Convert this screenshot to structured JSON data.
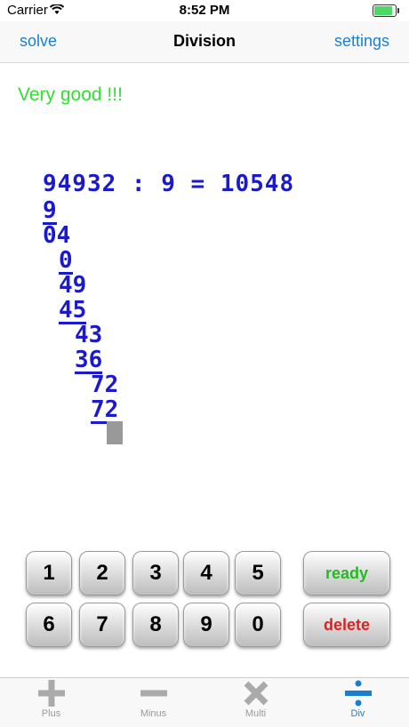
{
  "status": {
    "carrier": "Carrier",
    "time": "8:52 PM"
  },
  "nav": {
    "left": "solve",
    "title": "Division",
    "right": "settings"
  },
  "feedback": "Very good !!!",
  "division": {
    "equation": "94932 : 9 = 10548",
    "steps": [
      "9",
      "04",
      "0",
      "49",
      "45",
      "43",
      "36",
      "72",
      "72"
    ]
  },
  "keypad": {
    "digits_row1": [
      "1",
      "2",
      "3",
      "4",
      "5"
    ],
    "digits_row2": [
      "6",
      "7",
      "8",
      "9",
      "0"
    ],
    "ready": "ready",
    "delete": "delete"
  },
  "tabs": [
    {
      "label": "Plus",
      "icon": "plus-icon"
    },
    {
      "label": "Minus",
      "icon": "minus-icon"
    },
    {
      "label": "Multi",
      "icon": "times-icon"
    },
    {
      "label": "Div",
      "icon": "divide-icon"
    }
  ],
  "colors": {
    "accent": "#1a7fd1",
    "math": "#1a1acc",
    "success": "#33dd33",
    "ready": "#22bb22",
    "delete": "#dd2222"
  }
}
